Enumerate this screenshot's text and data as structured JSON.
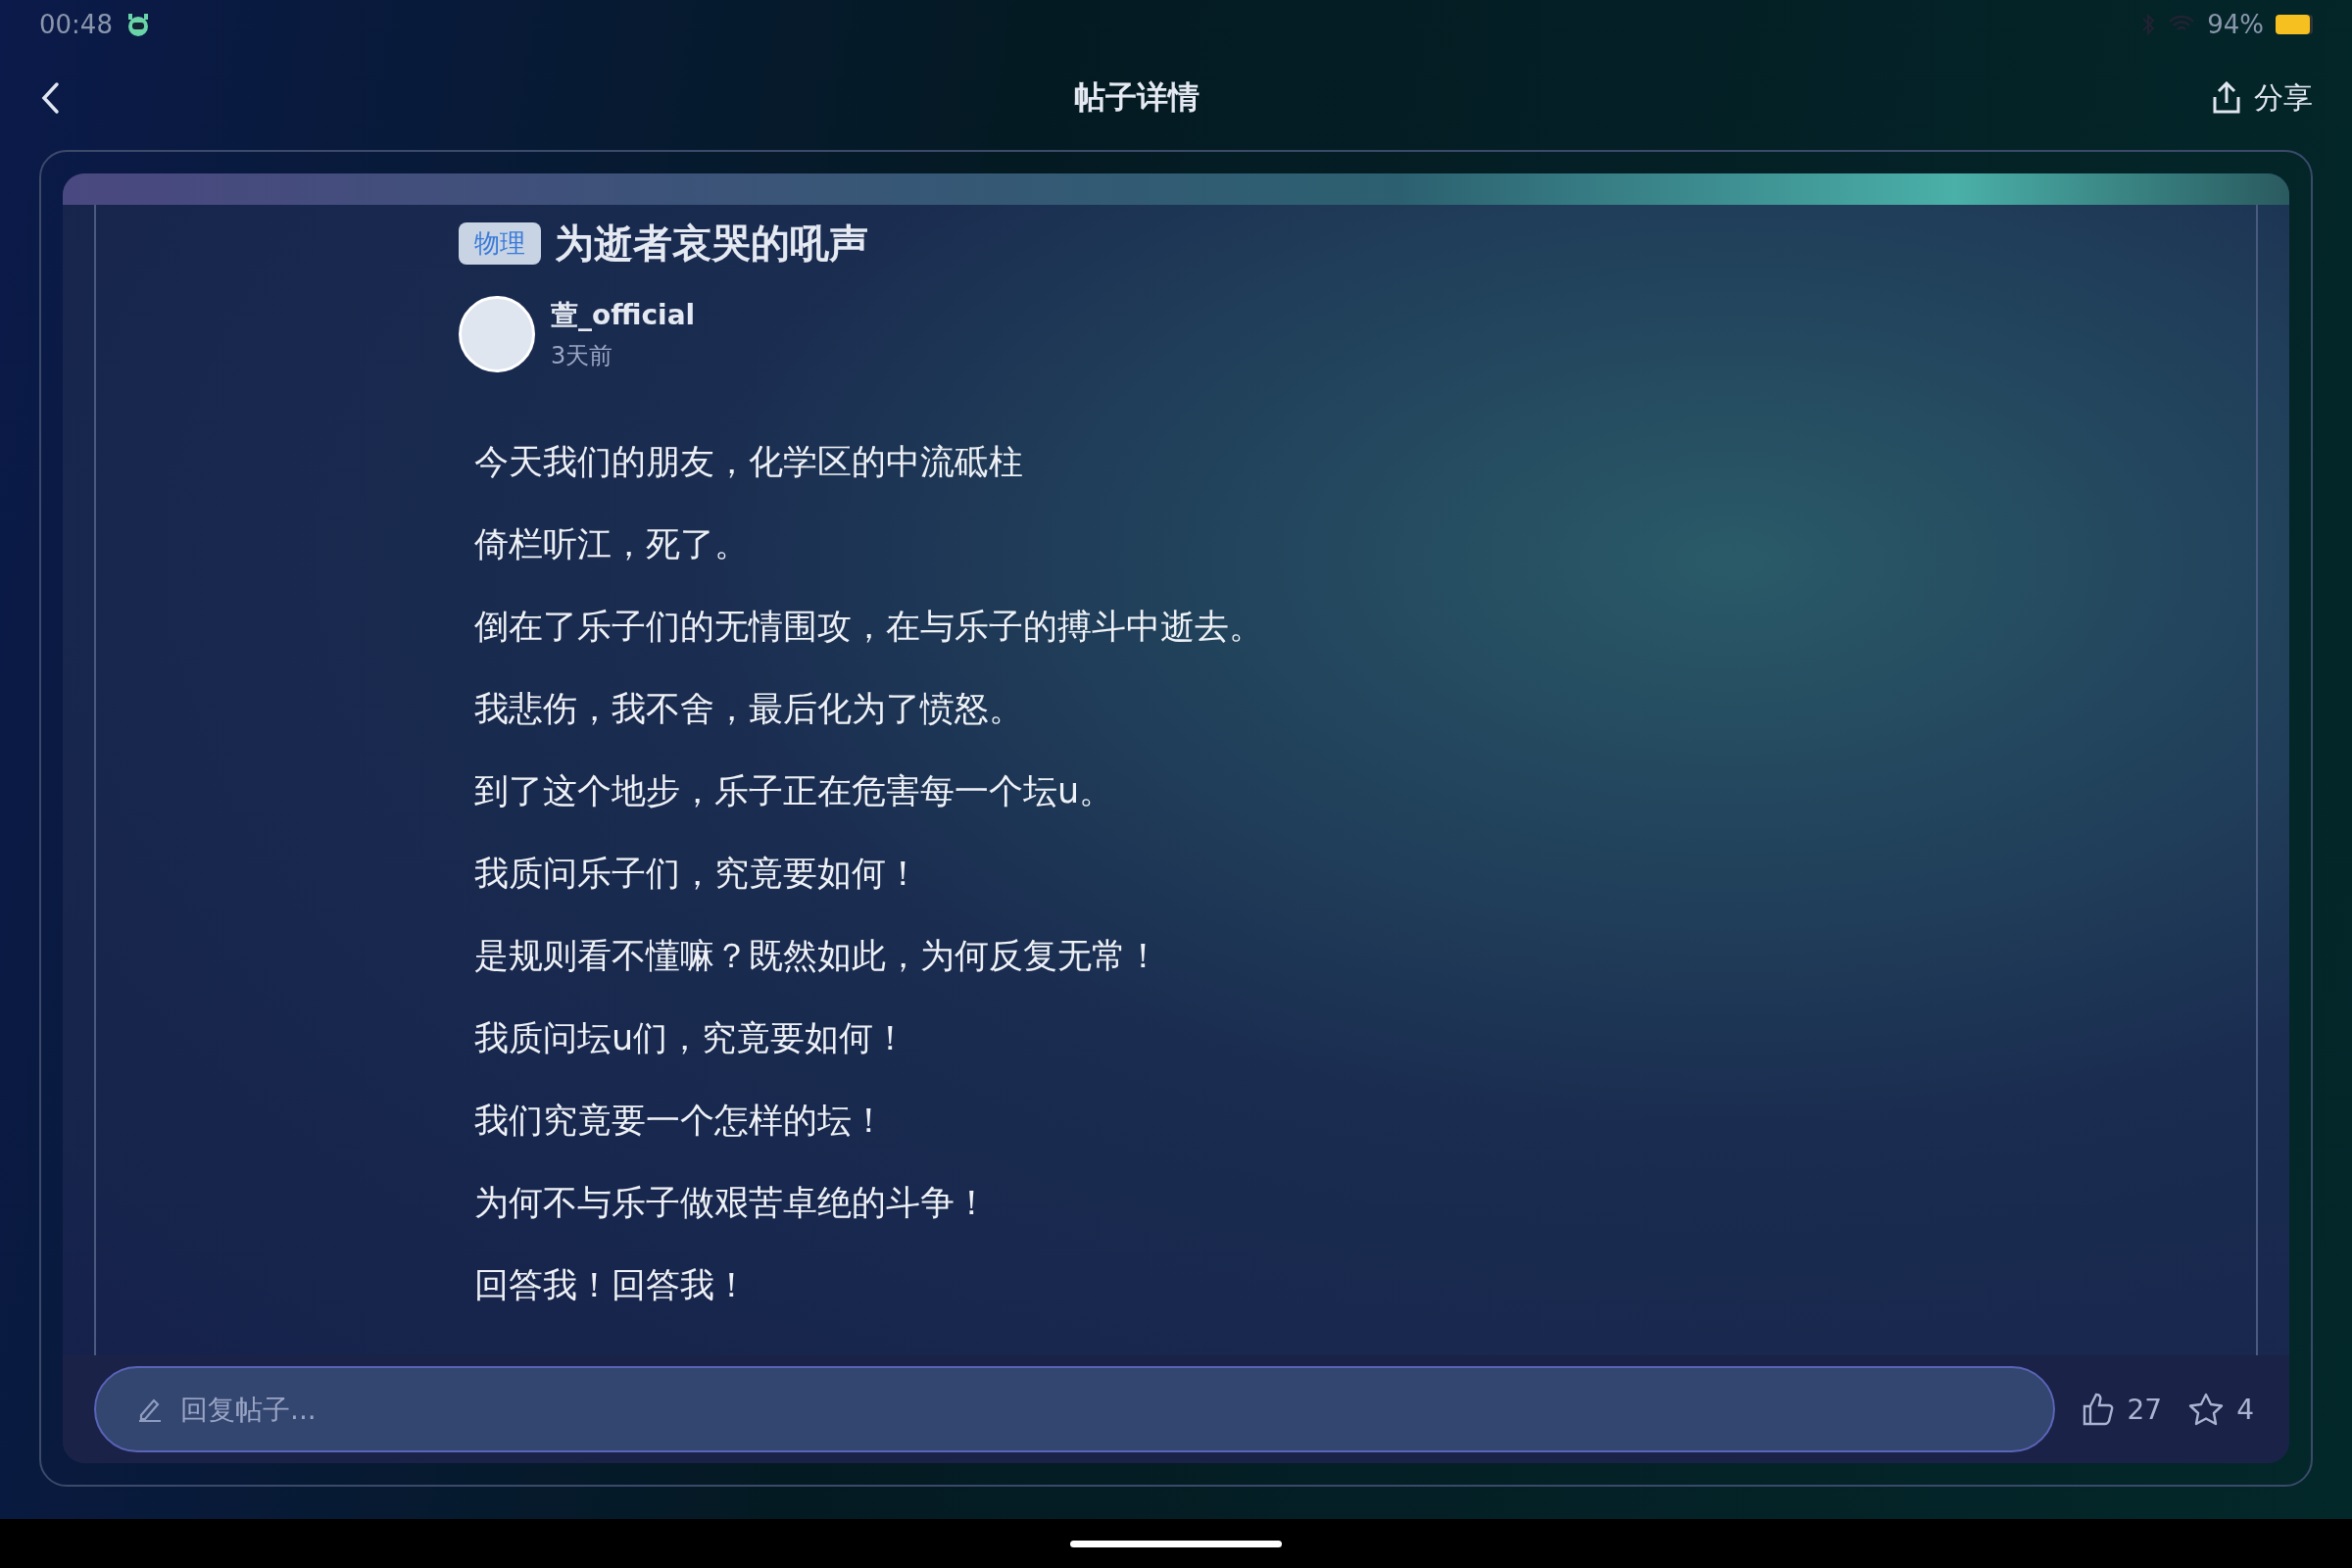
{
  "status_bar": {
    "time": "00:48",
    "battery": "94%"
  },
  "header": {
    "title": "帖子详情",
    "share": "分享"
  },
  "post": {
    "tag": "物理",
    "title": "为逝者哀哭的吼声",
    "author": "萱_official",
    "time": "3天前",
    "lines": [
      "今天我们的朋友，化学区的中流砥柱",
      "倚栏听江，死了。",
      "倒在了乐子们的无情围攻，在与乐子的搏斗中逝去。",
      "我悲伤，我不舍，最后化为了愤怒。",
      "到了这个地步，乐子正在危害每一个坛u。",
      "我质问乐子们，究竟要如何！",
      "是规则看不懂嘛？既然如此，为何反复无常！",
      "我质问坛u们，究竟要如何！",
      "我们究竟要一个怎样的坛！",
      "为何不与乐子做艰苦卓绝的斗争！",
      "回答我！回答我！"
    ]
  },
  "reply_bar": {
    "placeholder": "回复帖子...",
    "likes": "27",
    "favorites": "4"
  }
}
